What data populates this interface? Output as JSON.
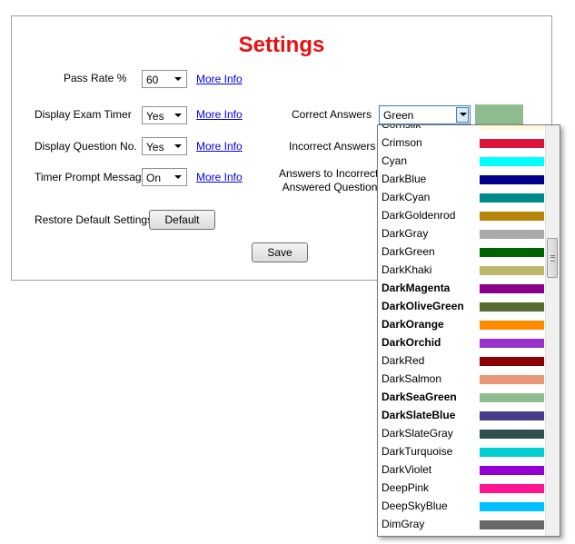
{
  "title": "Settings",
  "settings": {
    "pass_rate": {
      "label": "Pass Rate %",
      "value": "60",
      "more_info": "More Info"
    },
    "exam_timer": {
      "label": "Display Exam Timer",
      "value": "Yes",
      "more_info": "More Info"
    },
    "question_no": {
      "label": "Display Question No.",
      "value": "Yes",
      "more_info": "More Info"
    },
    "timer_prompt": {
      "label": "Timer Prompt Message",
      "value": "On",
      "more_info": "More Info"
    },
    "restore": {
      "label": "Restore Default Settings",
      "button": "Default"
    }
  },
  "colors": {
    "correct": {
      "label": "Correct Answers",
      "value": "Green",
      "swatch": "#8fbc8f"
    },
    "incorrect": {
      "label": "Incorrect Answers"
    },
    "incorrectly_line1": "Answers to Incorrectly",
    "incorrectly_line2": "Answered Questions"
  },
  "save_button": "Save",
  "dropdown_options": [
    {
      "name": "Cornsilk",
      "color": "#fff8dc",
      "bold": false
    },
    {
      "name": "Crimson",
      "color": "#dc143c",
      "bold": false
    },
    {
      "name": "Cyan",
      "color": "#00ffff",
      "bold": false
    },
    {
      "name": "DarkBlue",
      "color": "#00008b",
      "bold": false
    },
    {
      "name": "DarkCyan",
      "color": "#008b8b",
      "bold": false
    },
    {
      "name": "DarkGoldenrod",
      "color": "#b8860b",
      "bold": false
    },
    {
      "name": "DarkGray",
      "color": "#a9a9a9",
      "bold": false
    },
    {
      "name": "DarkGreen",
      "color": "#006400",
      "bold": false
    },
    {
      "name": "DarkKhaki",
      "color": "#bdb76b",
      "bold": false
    },
    {
      "name": "DarkMagenta",
      "color": "#8b008b",
      "bold": true
    },
    {
      "name": "DarkOliveGreen",
      "color": "#556b2f",
      "bold": true
    },
    {
      "name": "DarkOrange",
      "color": "#ff8c00",
      "bold": true
    },
    {
      "name": "DarkOrchid",
      "color": "#9932cc",
      "bold": true
    },
    {
      "name": "DarkRed",
      "color": "#8b0000",
      "bold": false
    },
    {
      "name": "DarkSalmon",
      "color": "#e9967a",
      "bold": false
    },
    {
      "name": "DarkSeaGreen",
      "color": "#8fbc8f",
      "bold": true
    },
    {
      "name": "DarkSlateBlue",
      "color": "#483d8b",
      "bold": true
    },
    {
      "name": "DarkSlateGray",
      "color": "#2f4f4f",
      "bold": false
    },
    {
      "name": "DarkTurquoise",
      "color": "#00ced1",
      "bold": false
    },
    {
      "name": "DarkViolet",
      "color": "#9400d3",
      "bold": false
    },
    {
      "name": "DeepPink",
      "color": "#ff1493",
      "bold": false
    },
    {
      "name": "DeepSkyBlue",
      "color": "#00bfff",
      "bold": false
    },
    {
      "name": "DimGray",
      "color": "#696969",
      "bold": false
    }
  ]
}
